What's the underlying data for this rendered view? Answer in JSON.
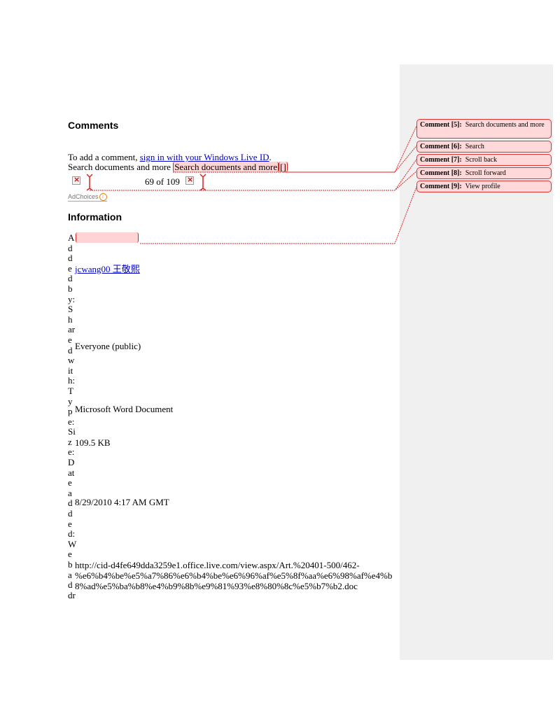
{
  "comments_section": {
    "heading": "Comments",
    "prompt_prefix": "To add a comment, ",
    "sign_in_link": "sign in with your Windows Live ID",
    "prompt_suffix": ".",
    "search_label": "Search documents and more",
    "search_highlight": "Search documents and more",
    "search_button_glyph": "[]",
    "pager": "69 of 109",
    "adchoices": "AdChoices"
  },
  "information": {
    "heading": "Information",
    "added_by_label": "Added by:",
    "added_by_value": "jcwang00 王敬熙",
    "shared_with_label": "Shared with:",
    "shared_with_value": "Everyone (public)",
    "type_label": "Type:",
    "type_value": "Microsoft Word Document",
    "size_label": "Size:",
    "size_value": "109.5 KB",
    "date_added_label": "Date added:",
    "date_added_value": "8/29/2010 4:17 AM GMT",
    "web_address_label": "Web addr",
    "web_address_lines": [
      "http://cid-d4fe649dda3259e1.office.live.com/view.aspx/Art.%20401-500/462-",
      "%e6%b4%be%e5%a7%86%e6%b4%be%e6%96%af%e5%8f%aa%e6%98%af%e4%b",
      "8%ad%e5%ba%b8%e4%b9%8b%e9%81%93%e8%80%8c%e5%b7%b2.doc"
    ]
  },
  "comments": [
    {
      "tag": "Comment [5]:",
      "text": "Search documents and more"
    },
    {
      "tag": "Comment [6]:",
      "text": "Search"
    },
    {
      "tag": "Comment [7]:",
      "text": "Scroll back"
    },
    {
      "tag": "Comment [8]:",
      "text": "Scroll forward"
    },
    {
      "tag": "Comment [9]:",
      "text": "View profile"
    }
  ],
  "colors": {
    "highlight": "#ffd4d4",
    "markup_red": "#dd2222",
    "link": "#0000cc",
    "markup_pane": "#f0f0f0"
  }
}
